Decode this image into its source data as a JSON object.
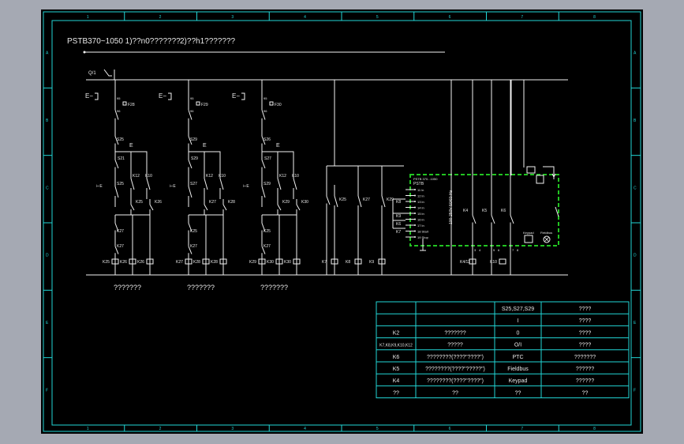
{
  "header": {
    "title_1": "PSTB370~1050 1)??n0???????",
    "title_2": "2)??h1???????"
  },
  "frame": {
    "columns": [
      "1",
      "2",
      "3",
      "4",
      "5",
      "6",
      "7",
      "8"
    ],
    "rows": [
      "A",
      "B",
      "C",
      "D",
      "E",
      "F"
    ]
  },
  "supply": {
    "switch_label": "Q/1"
  },
  "groups": [
    {
      "fuse": "F28",
      "f_no": "95",
      "f_nc": "96",
      "stop": "S25",
      "start": "S21",
      "jog": "S25",
      "k_a": "K12",
      "k_b": "K10",
      "k_c": "K25",
      "k_d": "K26",
      "low1": "K27",
      "low2": "K27",
      "coil1": "K25",
      "coil2": "K26",
      "coil3": "K26",
      "caption": "???????"
    },
    {
      "fuse": "F29",
      "f_no": "95",
      "f_nc": "96",
      "stop": "S29",
      "start": "S29",
      "jog": "S27",
      "k_a": "K12",
      "k_b": "K10",
      "k_c": "K27",
      "k_d": "K28",
      "low1": "K25",
      "low2": "K27",
      "coil1": "K27",
      "coil2": "K28",
      "coil3": "K28",
      "caption": "???????"
    },
    {
      "fuse": "F30",
      "f_no": "95",
      "f_nc": "96",
      "stop": "S26",
      "start": "S27",
      "jog": "S29",
      "k_a": "K12",
      "k_b": "K10",
      "k_c": "K29",
      "k_d": "K30",
      "low1": "K25",
      "low2": "K27",
      "coil1": "K29",
      "coil2": "K30",
      "coil3": "K30",
      "caption": "???????"
    }
  ],
  "right_contacts": [
    "K25",
    "K27",
    "K29"
  ],
  "right_coils": [
    "K7",
    "K8",
    "K9"
  ],
  "module": {
    "title": "PSTB",
    "subtitle": "PSTB 370...1050",
    "inputs": [
      "11 ln",
      "12 ln",
      "13 ln",
      "14 ln",
      "15 ln",
      "16 ln",
      "17 ln",
      "18 Start",
      "19 Stop"
    ],
    "voltage": "100-250V 50/60 Hz",
    "relays": [
      "K4",
      "K5",
      "K6"
    ],
    "keypad": "Keypad",
    "fieldbus": "Fieldbus",
    "terminals": [
      "3",
      "4",
      "5",
      "6",
      "7",
      "8"
    ],
    "coils": [
      "K4/12",
      "K10"
    ],
    "input_refs": [
      "K8",
      "K9",
      "K6",
      "K7"
    ]
  },
  "table": {
    "rows": [
      [
        "",
        "",
        "S25,S27,S29",
        "????"
      ],
      [
        "",
        "",
        "I",
        "????"
      ],
      [
        "K2",
        "???????",
        "0",
        "????"
      ],
      [
        "K7,K8,K9,K10,K12",
        "?????",
        "O/I",
        "????"
      ],
      [
        "K6",
        "????????(????\"????\")",
        "PTC",
        "???????"
      ],
      [
        "K5",
        "????????(????\"?????\")",
        "Fieldbus",
        "??????"
      ],
      [
        "K4",
        "????????(????\"????\")",
        "Keypad",
        "??????"
      ],
      [
        "??",
        "??",
        "??",
        "??"
      ]
    ]
  },
  "colors": {
    "background": "#a5a9b3",
    "sheet": "#000000",
    "frame": "#22d6d6",
    "wire": "#f2f2f2",
    "module_border": "#22c422",
    "contact": "#e6e64a"
  }
}
